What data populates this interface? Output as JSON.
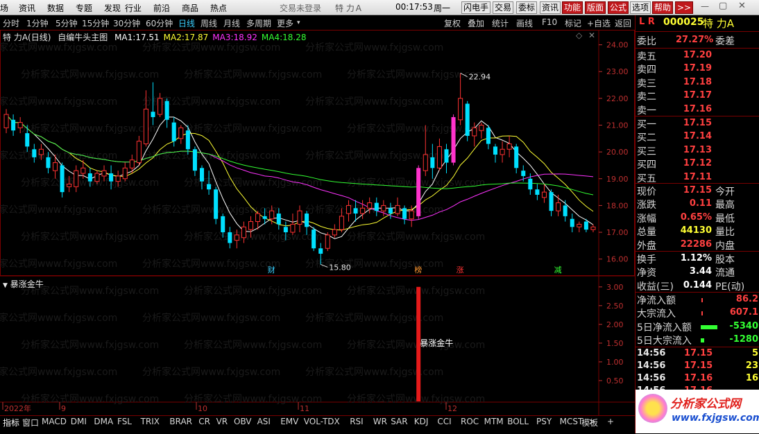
{
  "menu": {
    "items": [
      "场",
      "资讯",
      "数据",
      "专题",
      "发现",
      "行业",
      "前沿",
      "商品",
      "热点"
    ],
    "status": "交易未登录",
    "stock_title": "特 力Ａ",
    "time": "00:17:53",
    "weekday": "周一",
    "buttons": [
      "闪电手",
      "交易",
      "委标",
      "资讯",
      "功能",
      "版面",
      "公式",
      "选项",
      "帮助",
      ">>"
    ]
  },
  "periods": {
    "items": [
      "分时",
      "1分钟",
      "5分钟",
      "15分钟",
      "30分钟",
      "60分钟",
      "日线",
      "周线",
      "月线",
      "多周期",
      "更多"
    ],
    "active": "日线",
    "tools": [
      "复权",
      "叠加",
      "统计",
      "画线",
      "F10",
      "标记",
      "+自选",
      "返回"
    ]
  },
  "main_chart": {
    "title": "特 力A(日线)",
    "subtitle": "自编牛头主图",
    "ma": [
      {
        "label": "MA1:",
        "value": "17.51",
        "color": "#ffffff"
      },
      {
        "label": "MA2:",
        "value": "17.87",
        "color": "#ffff33"
      },
      {
        "label": "MA3:",
        "value": "18.92",
        "color": "#ff33ff"
      },
      {
        "label": "MA4:",
        "value": "18.28",
        "color": "#33ff33"
      }
    ],
    "y_ticks": [
      "24.00",
      "23.00",
      "22.00",
      "21.00",
      "20.00",
      "19.00",
      "18.00",
      "17.00",
      "16.00"
    ],
    "high_label": "22.94",
    "low_label": "15.80",
    "markers": [
      "财",
      "榜",
      "涨",
      "减"
    ],
    "watermark": "分析家公式网www.fxjgsw.com"
  },
  "chart_data": {
    "type": "candlestick",
    "candles": [
      {
        "o": 20.9,
        "c": 21.4,
        "h": 21.6,
        "l": 20.7
      },
      {
        "o": 21.2,
        "c": 20.8,
        "h": 21.4,
        "l": 20.6
      },
      {
        "o": 20.9,
        "c": 21.1,
        "h": 21.3,
        "l": 20.7
      },
      {
        "o": 20.7,
        "c": 20.2,
        "h": 21.0,
        "l": 20.0
      },
      {
        "o": 20.1,
        "c": 19.8,
        "h": 20.3,
        "l": 19.6
      },
      {
        "o": 19.9,
        "c": 20.1,
        "h": 20.3,
        "l": 19.7
      },
      {
        "o": 19.8,
        "c": 19.4,
        "h": 20.0,
        "l": 19.2
      },
      {
        "o": 19.3,
        "c": 19.6,
        "h": 19.9,
        "l": 19.0
      },
      {
        "o": 19.5,
        "c": 18.5,
        "h": 19.6,
        "l": 18.3
      },
      {
        "o": 18.7,
        "c": 18.8,
        "h": 19.1,
        "l": 18.5
      },
      {
        "o": 18.7,
        "c": 19.3,
        "h": 19.5,
        "l": 18.5
      },
      {
        "o": 19.2,
        "c": 19.4,
        "h": 19.7,
        "l": 19.0
      },
      {
        "o": 19.2,
        "c": 18.9,
        "h": 19.4,
        "l": 18.7
      },
      {
        "o": 18.9,
        "c": 19.2,
        "h": 19.3,
        "l": 18.8
      },
      {
        "o": 19.1,
        "c": 19.3,
        "h": 19.5,
        "l": 18.9
      },
      {
        "o": 19.2,
        "c": 18.9,
        "h": 19.5,
        "l": 18.6
      },
      {
        "o": 18.9,
        "c": 19.1,
        "h": 19.3,
        "l": 18.7
      },
      {
        "o": 19.0,
        "c": 19.4,
        "h": 19.6,
        "l": 18.9
      },
      {
        "o": 19.4,
        "c": 19.7,
        "h": 19.9,
        "l": 19.2
      },
      {
        "o": 19.6,
        "c": 20.4,
        "h": 20.6,
        "l": 19.5
      },
      {
        "o": 20.3,
        "c": 21.6,
        "h": 22.3,
        "l": 20.2
      },
      {
        "o": 21.5,
        "c": 21.3,
        "h": 22.6,
        "l": 21.0
      },
      {
        "o": 21.4,
        "c": 22.0,
        "h": 22.2,
        "l": 21.3
      },
      {
        "o": 21.9,
        "c": 21.2,
        "h": 22.0,
        "l": 20.9
      },
      {
        "o": 21.1,
        "c": 20.4,
        "h": 21.3,
        "l": 20.2
      },
      {
        "o": 20.5,
        "c": 20.9,
        "h": 21.0,
        "l": 20.3
      },
      {
        "o": 20.8,
        "c": 20.1,
        "h": 21.0,
        "l": 19.9
      },
      {
        "o": 20.1,
        "c": 19.3,
        "h": 20.2,
        "l": 19.1
      },
      {
        "o": 19.4,
        "c": 18.9,
        "h": 19.5,
        "l": 18.6
      },
      {
        "o": 18.8,
        "c": 18.6,
        "h": 19.3,
        "l": 18.4
      },
      {
        "o": 18.6,
        "c": 17.5,
        "h": 18.7,
        "l": 17.3
      },
      {
        "o": 17.6,
        "c": 17.0,
        "h": 17.7,
        "l": 16.8
      },
      {
        "o": 17.0,
        "c": 16.6,
        "h": 17.2,
        "l": 16.4
      },
      {
        "o": 16.7,
        "c": 16.9,
        "h": 17.1,
        "l": 16.4
      },
      {
        "o": 16.8,
        "c": 17.2,
        "h": 17.4,
        "l": 16.6
      },
      {
        "o": 17.1,
        "c": 17.4,
        "h": 17.6,
        "l": 16.8
      },
      {
        "o": 17.4,
        "c": 17.7,
        "h": 17.8,
        "l": 17.1
      },
      {
        "o": 17.6,
        "c": 17.5,
        "h": 17.9,
        "l": 17.3
      },
      {
        "o": 17.5,
        "c": 17.8,
        "h": 18.0,
        "l": 17.3
      },
      {
        "o": 17.7,
        "c": 17.3,
        "h": 17.9,
        "l": 17.1
      },
      {
        "o": 17.2,
        "c": 17.0,
        "h": 17.4,
        "l": 16.7
      },
      {
        "o": 17.0,
        "c": 17.3,
        "h": 17.7,
        "l": 16.9
      },
      {
        "o": 17.3,
        "c": 17.8,
        "h": 18.0,
        "l": 17.0
      },
      {
        "o": 17.7,
        "c": 17.2,
        "h": 17.8,
        "l": 16.9
      },
      {
        "o": 17.1,
        "c": 16.4,
        "h": 17.2,
        "l": 16.3
      },
      {
        "o": 16.4,
        "c": 16.2,
        "h": 16.6,
        "l": 15.8
      },
      {
        "o": 16.4,
        "c": 16.9,
        "h": 17.0,
        "l": 16.3
      },
      {
        "o": 16.9,
        "c": 17.1,
        "h": 17.3,
        "l": 16.8
      },
      {
        "o": 17.1,
        "c": 17.6,
        "h": 17.9,
        "l": 17.0
      },
      {
        "o": 17.7,
        "c": 18.0,
        "h": 18.2,
        "l": 17.4
      },
      {
        "o": 17.9,
        "c": 17.7,
        "h": 18.2,
        "l": 17.4
      },
      {
        "o": 17.7,
        "c": 17.9,
        "h": 18.2,
        "l": 17.5
      },
      {
        "o": 17.9,
        "c": 18.1,
        "h": 18.3,
        "l": 17.7
      },
      {
        "o": 18.1,
        "c": 17.8,
        "h": 18.3,
        "l": 17.6
      },
      {
        "o": 17.8,
        "c": 18.0,
        "h": 18.2,
        "l": 17.6
      },
      {
        "o": 17.9,
        "c": 17.7,
        "h": 18.1,
        "l": 17.5
      },
      {
        "o": 17.7,
        "c": 18.0,
        "h": 18.3,
        "l": 17.6
      },
      {
        "o": 17.9,
        "c": 17.5,
        "h": 18.0,
        "l": 17.3
      },
      {
        "o": 17.5,
        "c": 17.8,
        "h": 18.0,
        "l": 17.2
      },
      {
        "o": 17.6,
        "c": 19.4,
        "h": 19.5,
        "l": 17.5
      },
      {
        "o": 19.3,
        "c": 19.9,
        "h": 21.0,
        "l": 19.1
      },
      {
        "o": 19.8,
        "c": 19.4,
        "h": 20.3,
        "l": 19.0
      },
      {
        "o": 19.4,
        "c": 20.2,
        "h": 20.5,
        "l": 19.3
      },
      {
        "o": 20.1,
        "c": 19.6,
        "h": 20.3,
        "l": 19.2
      },
      {
        "o": 19.6,
        "c": 21.3,
        "h": 21.4,
        "l": 19.5
      },
      {
        "o": 21.2,
        "c": 22.0,
        "h": 22.94,
        "l": 21.0
      },
      {
        "o": 21.8,
        "c": 20.6,
        "h": 21.9,
        "l": 20.4
      },
      {
        "o": 20.6,
        "c": 20.9,
        "h": 21.1,
        "l": 20.2
      },
      {
        "o": 20.8,
        "c": 21.0,
        "h": 21.1,
        "l": 20.5
      },
      {
        "o": 20.9,
        "c": 20.3,
        "h": 21.0,
        "l": 20.1
      },
      {
        "o": 20.2,
        "c": 19.9,
        "h": 20.3,
        "l": 19.6
      },
      {
        "o": 19.9,
        "c": 20.1,
        "h": 20.4,
        "l": 19.6
      },
      {
        "o": 20.1,
        "c": 20.3,
        "h": 20.6,
        "l": 19.8
      },
      {
        "o": 20.2,
        "c": 19.4,
        "h": 20.3,
        "l": 19.2
      },
      {
        "o": 19.3,
        "c": 19.1,
        "h": 19.5,
        "l": 18.9
      },
      {
        "o": 19.0,
        "c": 18.6,
        "h": 19.2,
        "l": 18.4
      },
      {
        "o": 18.6,
        "c": 18.4,
        "h": 18.8,
        "l": 18.2
      },
      {
        "o": 18.3,
        "c": 18.5,
        "h": 18.8,
        "l": 18.1
      },
      {
        "o": 18.5,
        "c": 17.8,
        "h": 18.6,
        "l": 17.6
      },
      {
        "o": 17.8,
        "c": 18.1,
        "h": 18.4,
        "l": 17.6
      },
      {
        "o": 18.0,
        "c": 17.6,
        "h": 18.2,
        "l": 17.4
      },
      {
        "o": 17.5,
        "c": 17.2,
        "h": 17.7,
        "l": 17.0
      },
      {
        "o": 17.2,
        "c": 17.3,
        "h": 17.4,
        "l": 17.0
      },
      {
        "o": 17.4,
        "c": 17.1,
        "h": 17.5,
        "l": 17.0
      },
      {
        "o": 17.1,
        "c": 17.2,
        "h": 17.3,
        "l": 17.0
      }
    ],
    "highlight_up": [
      59,
      64
    ],
    "ylim": [
      15.5,
      24.3
    ]
  },
  "sub_chart": {
    "title": "暴涨金牛",
    "label": "暴涨金牛",
    "y_ticks": [
      "3.00",
      "2.50",
      "2.00",
      "1.50",
      "1.00",
      "0.50"
    ],
    "signal_value": 3.0
  },
  "time_axis": [
    "2022年",
    "9",
    "10",
    "11",
    "12"
  ],
  "quote": {
    "code_prefix": "L R",
    "code": "000025",
    "name": "特 力A",
    "weibi_label": "委比",
    "weibi": "27.27%",
    "weicha_label": "委差",
    "asks": [
      {
        "label": "卖五",
        "price": "17.20"
      },
      {
        "label": "卖四",
        "price": "17.19"
      },
      {
        "label": "卖三",
        "price": "17.18"
      },
      {
        "label": "卖二",
        "price": "17.17"
      },
      {
        "label": "卖一",
        "price": "17.16"
      }
    ],
    "bids": [
      {
        "label": "买一",
        "price": "17.15"
      },
      {
        "label": "买二",
        "price": "17.14"
      },
      {
        "label": "买三",
        "price": "17.13"
      },
      {
        "label": "买四",
        "price": "17.12"
      },
      {
        "label": "买五",
        "price": "17.11"
      }
    ],
    "stats": [
      {
        "k": "现价",
        "v": "17.15",
        "k2": "今开",
        "color": "#ff4040"
      },
      {
        "k": "涨跌",
        "v": "0.11",
        "k2": "最高",
        "color": "#ff4040"
      },
      {
        "k": "涨幅",
        "v": "0.65%",
        "k2": "最低",
        "color": "#ff4040"
      },
      {
        "k": "总量",
        "v": "44130",
        "k2": "量比",
        "color": "#ffff33"
      },
      {
        "k": "外盘",
        "v": "22286",
        "k2": "内盘",
        "color": "#ff4040"
      }
    ],
    "stats2": [
      {
        "k": "换手",
        "v": "1.12%",
        "k2": "股本",
        "color": "#ffffff"
      },
      {
        "k": "净资",
        "v": "3.44",
        "k2": "流通",
        "color": "#ffffff"
      },
      {
        "k": "收益(三)",
        "v": "0.144",
        "k2": "PE(动)",
        "color": "#ffffff"
      }
    ],
    "flows": [
      {
        "k": "净流入额",
        "v": "86.2",
        "color": "#ff4040",
        "bar": "#ff4040",
        "bw": 2
      },
      {
        "k": "大宗流入",
        "v": "607.1",
        "color": "#ff4040",
        "bar": "#ff4040",
        "bw": 2
      },
      {
        "k": "5日净流入额",
        "v": "-5340",
        "color": "#33ff33",
        "bar": "#33ff33",
        "bw": 24
      },
      {
        "k": "5日大宗流入",
        "v": "-1280",
        "color": "#33ff33",
        "bar": "#33ff33",
        "bw": 5
      }
    ],
    "ticks": [
      {
        "t": "14:56",
        "p": "17.15",
        "v": "5"
      },
      {
        "t": "14:56",
        "p": "17.15",
        "v": "23"
      },
      {
        "t": "14:56",
        "p": "17.16",
        "v": "16"
      },
      {
        "t": "14:56",
        "p": "17.16",
        "v": ""
      }
    ]
  },
  "logo": {
    "name": "分析家公式网",
    "url": "www.fxjgsw.com"
  },
  "tabs": [
    "指标",
    "窗口",
    "MACD",
    "DMI",
    "DMA",
    "FSL",
    "TRIX",
    "BRAR",
    "CR",
    "VR",
    "OBV",
    "ASI",
    "EMV",
    "VOL-TDX",
    "RSI",
    "WR",
    "SAR",
    "KDJ",
    "CCI",
    "ROC",
    "MTM",
    "BOLL",
    "PSY",
    "MCST",
    ">"
  ],
  "template_label": "模板",
  "colors": {
    "up": "#ff3232",
    "down": "#00e0ff",
    "highlight": "#ff33cc",
    "bg": "#000000",
    "grid": "#7a0000",
    "axis": "#c03030"
  }
}
